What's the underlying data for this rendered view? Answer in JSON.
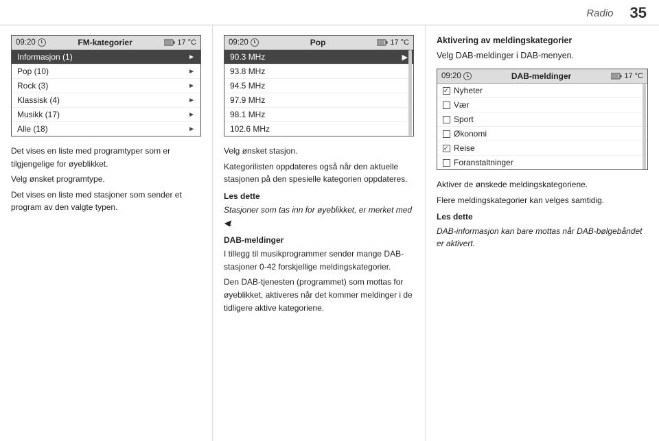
{
  "header": {
    "title": "Radio",
    "page_number": "35"
  },
  "left_panel": {
    "time": "09:20",
    "title": "FM-kategorier",
    "temp": "17 °C",
    "items": [
      {
        "label": "Informasjon (1)",
        "selected": true
      },
      {
        "label": "Pop (10)",
        "selected": false
      },
      {
        "label": "Rock (3)",
        "selected": false
      },
      {
        "label": "Klassisk (4)",
        "selected": false
      },
      {
        "label": "Musikk (17)",
        "selected": false
      },
      {
        "label": "Alle (18)",
        "selected": false
      }
    ]
  },
  "left_text": {
    "p1": "Det vises en liste med programtyper som er tilgjengelige for øyeblikket.",
    "p2": "Velg ønsket programtype.",
    "p3": "Det vises en liste med stasjoner som sender et program av den valgte typen."
  },
  "mid_panel": {
    "time": "09:20",
    "title": "Pop",
    "temp": "17 °C",
    "items": [
      {
        "label": "90.3 MHz",
        "active": true
      },
      {
        "label": "93.8 MHz",
        "active": false
      },
      {
        "label": "94.5 MHz",
        "active": false
      },
      {
        "label": "97.9 MHz",
        "active": false
      },
      {
        "label": "98.1 MHz",
        "active": false
      },
      {
        "label": "102.6 MHz",
        "active": false
      }
    ]
  },
  "mid_text": {
    "p1": "Velg ønsket stasjon.",
    "p2": "Kategorilisten oppdateres også når den aktuelle stasjonen på den spesielle kategorien oppdateres.",
    "les_dette_label": "Les dette",
    "les_dette_text": "Stasjoner som tas inn for øyeblikket, er merket med ◀.",
    "dab_label": "DAB-meldinger",
    "dab_text1": "I tillegg til musikprogrammer sender mange DAB-stasjoner 0-42 forskjellige meldingskategorier.",
    "dab_text2": "Den DAB-tjenesten (programmet) som mottas for øyeblikket, aktiveres når det kommer meldinger i de tidligere aktive kategoriene."
  },
  "right_heading1": "Aktivering av meldingskategorier",
  "right_heading2": "Velg DAB-meldinger i DAB-menyen.",
  "right_panel": {
    "time": "09:20",
    "title": "DAB-meldinger",
    "temp": "17 °C",
    "items": [
      {
        "label": "Nyheter",
        "checked": true
      },
      {
        "label": "Vær",
        "checked": false
      },
      {
        "label": "Sport",
        "checked": false
      },
      {
        "label": "Økonomi",
        "checked": false
      },
      {
        "label": "Reise",
        "checked": true
      },
      {
        "label": "Foranstaltninger",
        "checked": false
      }
    ]
  },
  "right_text": {
    "p1": "Aktiver de ønskede meldingskategoriene.",
    "p2": "Flere meldingskategorier kan velges samtidig.",
    "les_dette_label": "Les dette",
    "les_dette_text": "DAB-informasjon kan bare mottas når DAB-bølgebåndet er aktivert."
  }
}
